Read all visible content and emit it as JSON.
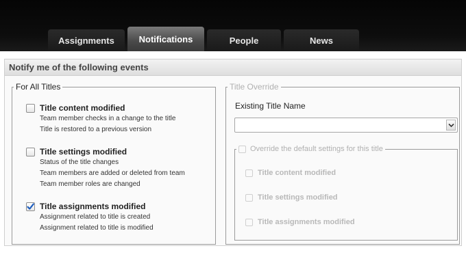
{
  "tabs": [
    {
      "label": "Assignments",
      "active": false
    },
    {
      "label": "Notifications",
      "active": true
    },
    {
      "label": "People",
      "active": false
    },
    {
      "label": "News",
      "active": false
    }
  ],
  "panel": {
    "title": "Notify me of the following events"
  },
  "all_titles": {
    "legend": "For All Titles",
    "items": [
      {
        "label": "Title content modified",
        "checked": false,
        "descriptions": [
          "Team member checks in a change to the title",
          "Title is restored to a previous version"
        ]
      },
      {
        "label": "Title settings modified",
        "checked": false,
        "descriptions": [
          "Status of the title changes",
          "Team members are added or deleted from team",
          "Team member roles are changed"
        ]
      },
      {
        "label": "Title assignments modified",
        "checked": true,
        "descriptions": [
          "Assignment related to title is created",
          "Assignment related to title is modified"
        ]
      }
    ]
  },
  "override": {
    "legend": "Title Override",
    "existing_label": "Existing Title Name",
    "select_value": "",
    "override_checkbox_label": "Override the default settings for this title",
    "items": [
      {
        "label": "Title content modified"
      },
      {
        "label": "Title settings modified"
      },
      {
        "label": "Title assignments modified"
      }
    ]
  },
  "colors": {
    "check_accent": "#1f5fbf",
    "tab_active": "#5a5a5a"
  }
}
